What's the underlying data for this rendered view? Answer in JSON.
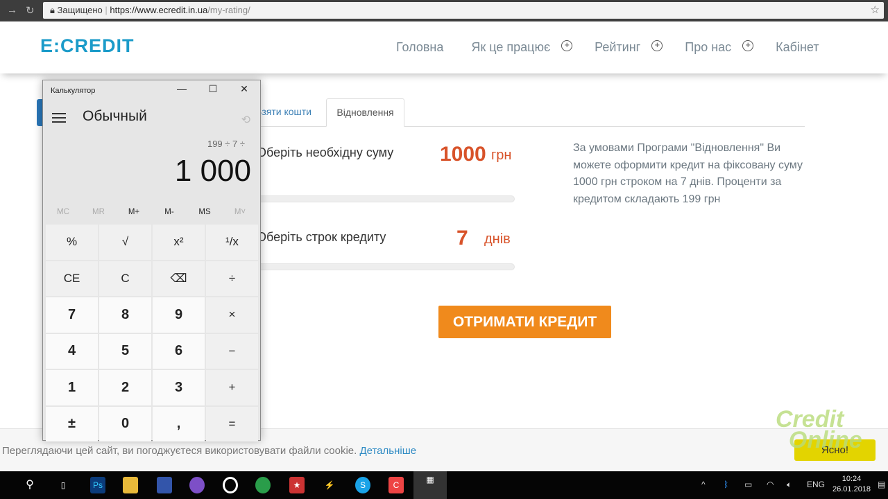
{
  "browser": {
    "secure_label": "Защищено",
    "url_host": "https://www.ecredit.in.ua",
    "url_path": "/my-rating/"
  },
  "site": {
    "logo": "E:CREDIT",
    "menu": [
      "Головна",
      "Як це працює",
      "Рейтинг",
      "Про нас",
      "Кабінет"
    ]
  },
  "tabs": [
    "Взяти кошти",
    "Відновлення"
  ],
  "form": {
    "amount_label": "Оберіть необхідну суму",
    "amount_value": "1000",
    "amount_unit": "грн",
    "term_label": "Оберіть строк кредиту",
    "term_value": "7",
    "term_unit": "днів",
    "cta": "ОТРИМАТИ КРЕДИТ"
  },
  "info": "За умовами Програми \"Відновлення\" Ви можете оформити кредит на фіксовану суму 1000 грн строком на 7 днів. Проценти за кредитом складають 199 грн",
  "cookie": {
    "text": "Переглядаючи цей сайт, ви погоджуєтеся використовувати файли cookie.",
    "link": "Детальніше",
    "ok": "Ясно!"
  },
  "watermark": "Credit Online",
  "calculator": {
    "title": "Калькулятор",
    "mode": "Обычный",
    "expression": "199 ÷ 7 ÷",
    "display": "1 000",
    "memory": [
      "MC",
      "MR",
      "M+",
      "M-",
      "MS",
      "M˅"
    ],
    "keys": [
      "%",
      "√",
      "x²",
      "¹/x",
      "CE",
      "C",
      "⌫",
      "÷",
      "7",
      "8",
      "9",
      "×",
      "4",
      "5",
      "6",
      "−",
      "1",
      "2",
      "3",
      "+",
      "±",
      "0",
      ",",
      "="
    ]
  },
  "taskbar": {
    "lang": "ENG",
    "time": "10:24",
    "date": "26.01.2018"
  }
}
